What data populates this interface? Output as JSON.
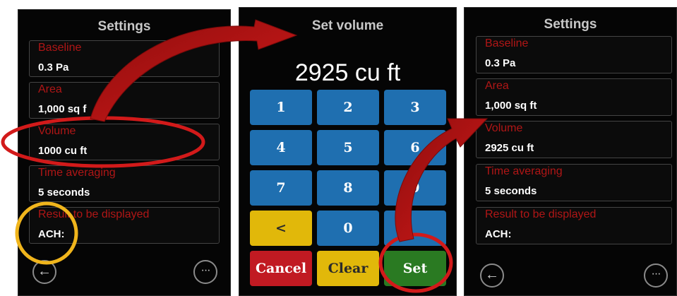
{
  "left_panel": {
    "title": "Settings",
    "fields": [
      {
        "label": "Baseline",
        "value": "0.3 Pa"
      },
      {
        "label": "Area",
        "value": "1,000 sq f"
      },
      {
        "label": "Volume",
        "value": "1000 cu ft"
      },
      {
        "label": "Time averaging",
        "value": "5 seconds"
      },
      {
        "label": "Result to be displayed",
        "value": "ACH: "
      }
    ],
    "back_icon": "←",
    "more_icon": "···"
  },
  "middle_panel": {
    "title": "Set volume",
    "display": "2925 cu ft",
    "keys": {
      "k1": "1",
      "k2": "2",
      "k3": "3",
      "k4": "4",
      "k5": "5",
      "k6": "6",
      "k7": "7",
      "k8": "8",
      "k9": "9",
      "backspace": "<",
      "k0": "0",
      "k_extra": "",
      "cancel": "Cancel",
      "clear": "Clear",
      "set": "Set"
    }
  },
  "right_panel": {
    "title": "Settings",
    "fields": [
      {
        "label": "Baseline",
        "value": "0.3 Pa"
      },
      {
        "label": "Area",
        "value": "1,000 sq ft"
      },
      {
        "label": "Volume",
        "value": "2925 cu ft"
      },
      {
        "label": "Time averaging",
        "value": "5 seconds"
      },
      {
        "label": "Result to be displayed",
        "value": "ACH:"
      }
    ],
    "back_icon": "←",
    "more_icon": "···"
  },
  "annotation_colors": {
    "ellipse": "#d21a1a",
    "arrow": "#c01515",
    "circle_yellow": "#f0b51c"
  }
}
